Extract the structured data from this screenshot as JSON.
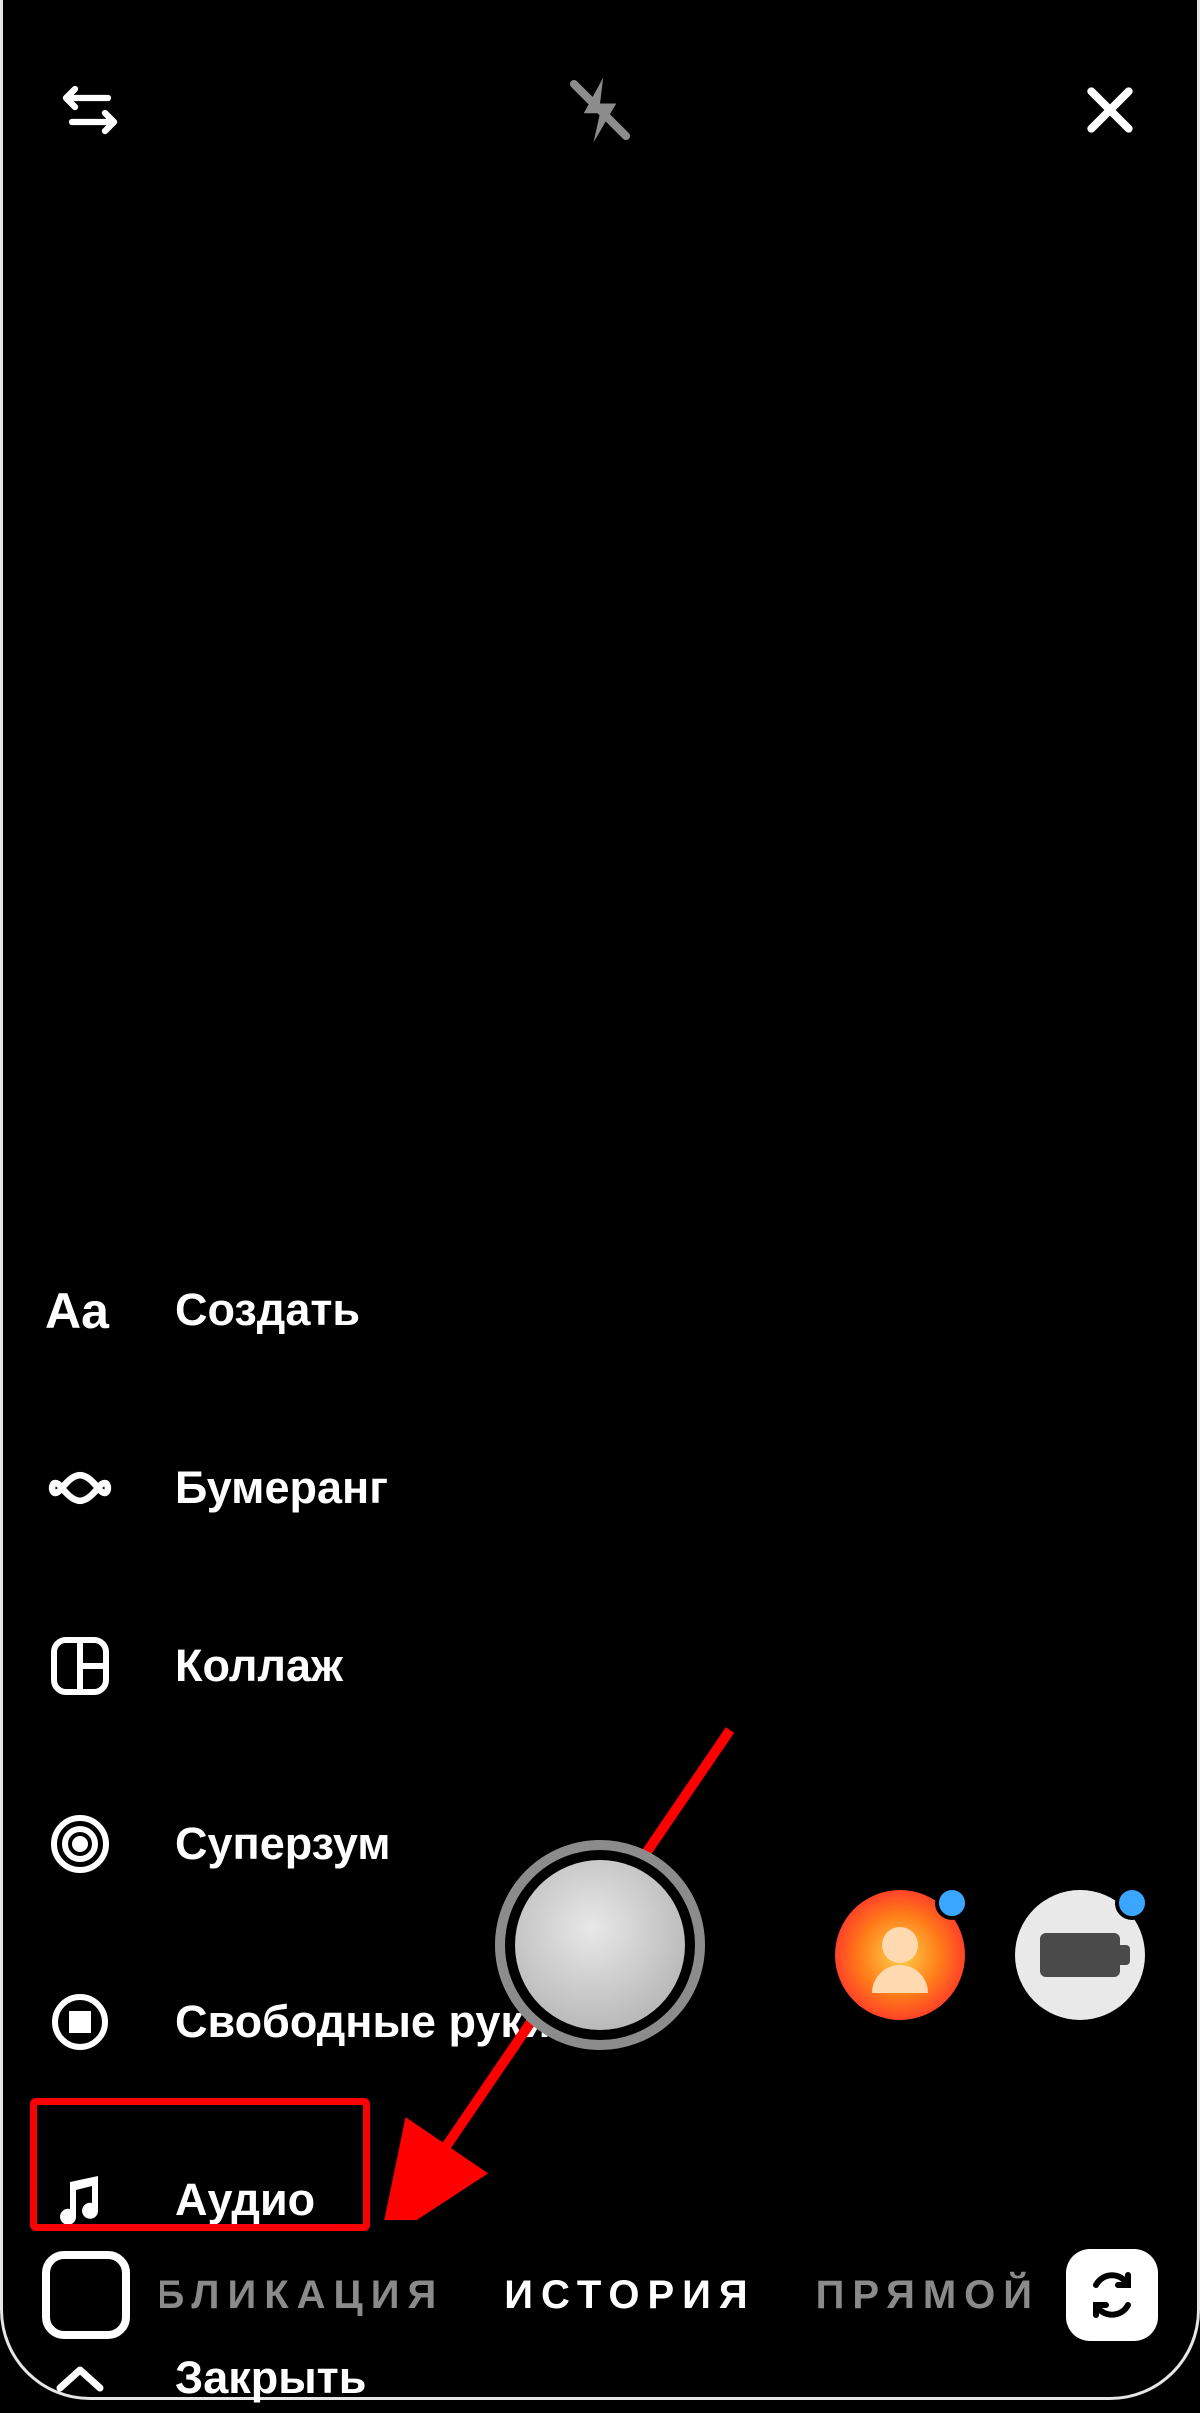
{
  "topbar": {
    "swap_icon": "swap-arrows-icon",
    "flash_icon": "flash-off-icon",
    "close_icon": "close-icon"
  },
  "menu": {
    "items": [
      {
        "icon": "text-aa-icon",
        "label": "Создать"
      },
      {
        "icon": "infinity-icon",
        "label": "Бумеранг"
      },
      {
        "icon": "collage-icon",
        "label": "Коллаж"
      },
      {
        "icon": "target-icon",
        "label": "Суперзум"
      },
      {
        "icon": "stop-circle-icon",
        "label": "Свободные руки"
      },
      {
        "icon": "music-note-icon",
        "label": "Аудио"
      },
      {
        "icon": "chevron-up-icon",
        "label": "Закрыть"
      }
    ],
    "highlighted_index": 5
  },
  "annotation": {
    "arrow_color": "#ff0000",
    "highlight_color": "#ff0000"
  },
  "capture": {
    "shutter_icon": "shutter-button",
    "effects": [
      {
        "name": "sunburst-avatar-effect",
        "badge": true
      },
      {
        "name": "gun-effect",
        "badge": true
      }
    ]
  },
  "modes": {
    "gallery_icon": "gallery-button",
    "switch_icon": "camera-switch-icon",
    "items": [
      {
        "label": "УБЛИКАЦИЯ",
        "active": false,
        "clip": "left"
      },
      {
        "label": "ИСТОРИЯ",
        "active": true
      },
      {
        "label": "ПРЯМОЙ ЭФ",
        "active": false,
        "clip": "right"
      }
    ]
  }
}
